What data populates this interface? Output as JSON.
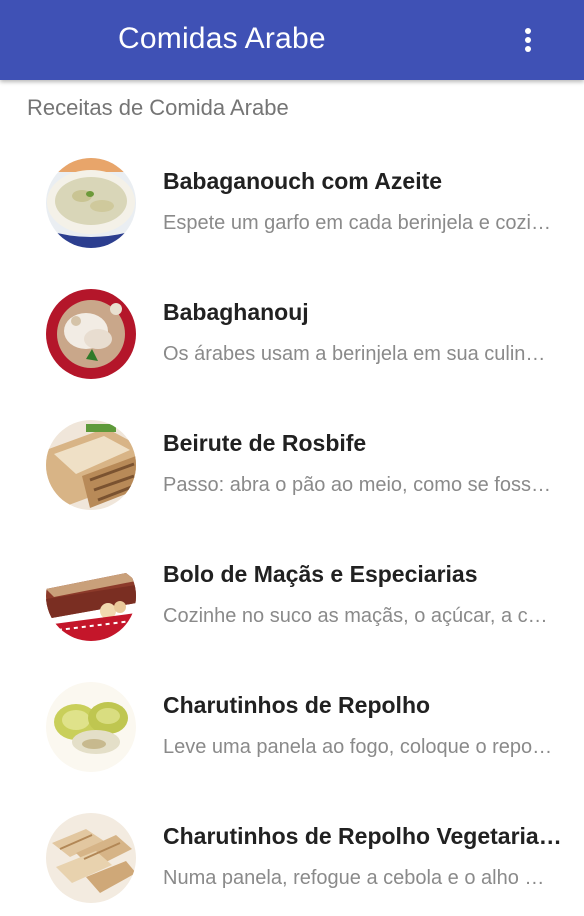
{
  "app_bar": {
    "title": "Comidas Arabe",
    "overflow_icon": "more-vert-icon",
    "color": "#3f51b5"
  },
  "section_header": "Receitas de Comida Arabe",
  "recipes": [
    {
      "title": "Babaganouch com Azeite",
      "subtitle": "Espete um garfo em cada berinjela e cozinhe até ficarem macias.",
      "thumbnail": "babaganouch-thumbnail"
    },
    {
      "title": "Babaghanouj",
      "subtitle": "Os árabes usam a berinjela em sua culinária de muitas formas.",
      "thumbnail": "babaghanouj-thumbnail"
    },
    {
      "title": "Beirute de Rosbife",
      "subtitle": "Passo: abra o pão ao meio, como se fosse um sanduíche.",
      "thumbnail": "beirute-thumbnail"
    },
    {
      "title": "Bolo de Maçãs e Especiarias",
      "subtitle": "Cozinhe no suco as maçãs, o açúcar, a canela e o cravo.",
      "thumbnail": "bolo-macas-thumbnail"
    },
    {
      "title": "Charutinhos de Repolho",
      "subtitle": "Leve uma panela ao fogo, coloque o repolho e cubra com água.",
      "thumbnail": "charutinhos-thumbnail"
    },
    {
      "title": "Charutinhos de Repolho Vegetariano",
      "subtitle": "Numa panela, refogue a cebola e o alho no azeite.",
      "thumbnail": "charutinhos-vegetariano-thumbnail"
    }
  ]
}
